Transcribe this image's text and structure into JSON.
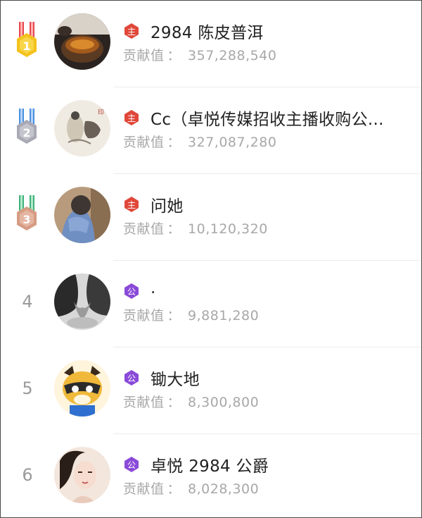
{
  "contrib_label": "贡献值",
  "contrib_sep": "：",
  "entries": [
    {
      "rank": "1",
      "medal": "gold-medal-icon",
      "badge_text": "主",
      "name": "2984 陈皮普洱",
      "value": "357,288,540"
    },
    {
      "rank": "2",
      "medal": "silver-medal-icon",
      "badge_text": "主",
      "name": "Cc（卓悦传媒招收主播收购公...",
      "value": "327,087,280"
    },
    {
      "rank": "3",
      "medal": "bronze-medal-icon",
      "badge_text": "主",
      "name": "问她",
      "value": "10,120,320"
    },
    {
      "rank": "4",
      "badge_text": "公",
      "name": ".",
      "value": "9,881,280"
    },
    {
      "rank": "5",
      "badge_text": "公",
      "name": "锄大地",
      "value": "8,300,800"
    },
    {
      "rank": "6",
      "badge_text": "公",
      "name": "卓悦 2984 公爵",
      "value": "8,028,300"
    }
  ],
  "colors": {
    "badge_host": "#e0483a",
    "badge_duke": "#8a4ad8",
    "gold": "#f4c21c",
    "silver": "#b3b3bd",
    "bronze": "#dba88f"
  }
}
